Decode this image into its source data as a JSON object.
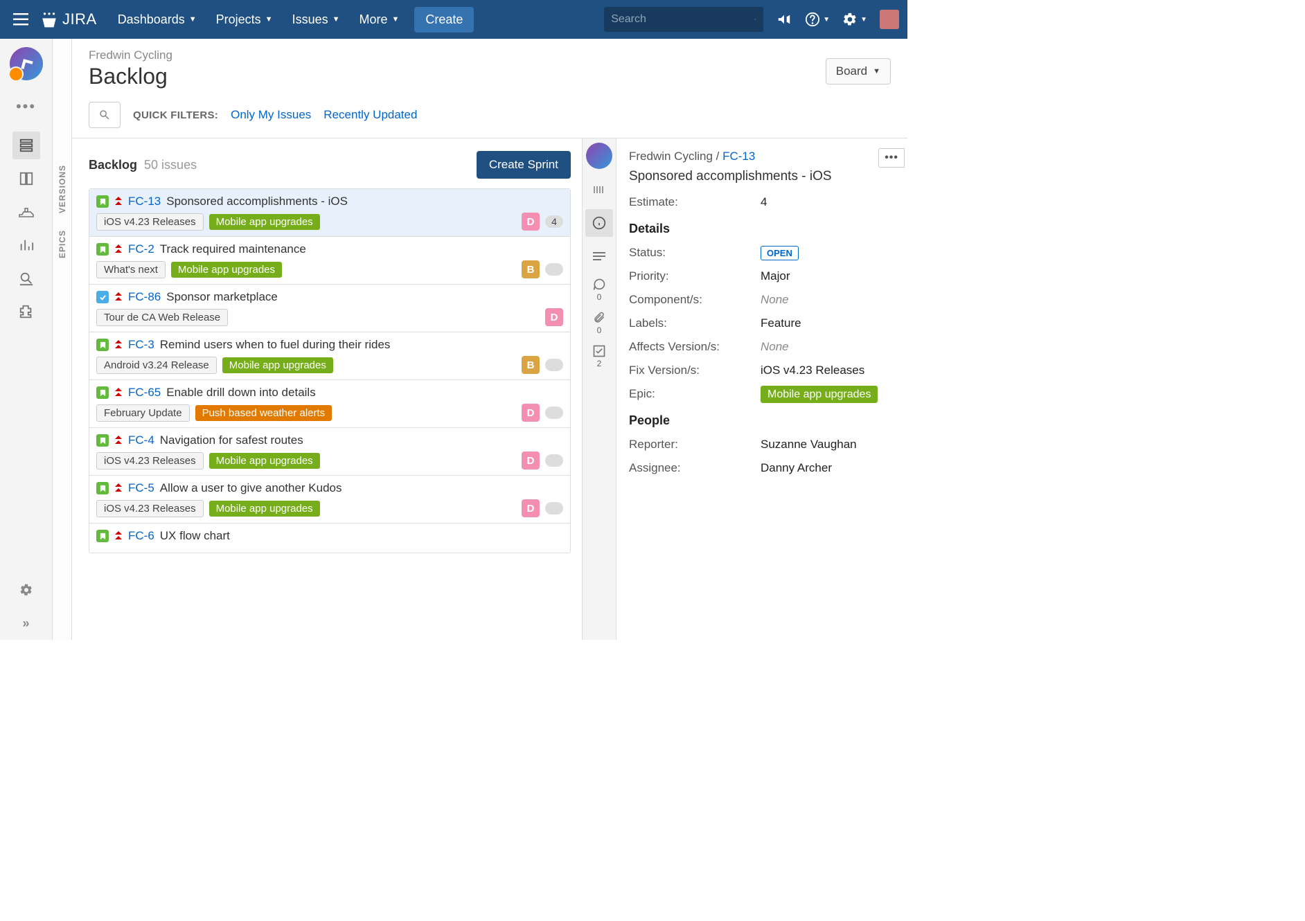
{
  "topbar": {
    "nav": [
      "Dashboards",
      "Projects",
      "Issues",
      "More"
    ],
    "create": "Create",
    "search_placeholder": "Search"
  },
  "vert_tabs": [
    "VERSIONS",
    "EPICS"
  ],
  "header": {
    "project": "Fredwin Cycling",
    "title": "Backlog",
    "board_btn": "Board"
  },
  "filters": {
    "label": "QUICK FILTERS:",
    "links": [
      "Only My Issues",
      "Recently Updated"
    ]
  },
  "backlog": {
    "title": "Backlog",
    "count": "50 issues",
    "create_sprint": "Create Sprint",
    "items": [
      {
        "type": "story",
        "key": "FC-13",
        "summary": "Sponsored accomplishments - iOS",
        "pills": [
          "iOS v4.23 Releases"
        ],
        "epic": "Mobile app upgrades",
        "epic_color": "green",
        "avatar": "D",
        "estimate": "4",
        "selected": true
      },
      {
        "type": "story",
        "key": "FC-2",
        "summary": "Track required maintenance",
        "pills": [
          "What's next"
        ],
        "epic": "Mobile app upgrades",
        "epic_color": "green",
        "avatar": "B",
        "estimate": ""
      },
      {
        "type": "task",
        "key": "FC-86",
        "summary": "Sponsor marketplace",
        "pills": [
          "Tour de CA Web Release"
        ],
        "epic": null,
        "avatar": "D",
        "estimate": null
      },
      {
        "type": "story",
        "key": "FC-3",
        "summary": "Remind users when to fuel during their rides",
        "pills": [
          "Android v3.24 Release"
        ],
        "epic": "Mobile app upgrades",
        "epic_color": "green",
        "avatar": "B",
        "estimate": ""
      },
      {
        "type": "story",
        "key": "FC-65",
        "summary": "Enable drill down into details",
        "pills": [
          "February Update"
        ],
        "epic": "Push based weather alerts",
        "epic_color": "orange",
        "avatar": "D",
        "estimate": ""
      },
      {
        "type": "story",
        "key": "FC-4",
        "summary": "Navigation for safest routes",
        "pills": [
          "iOS v4.23 Releases"
        ],
        "epic": "Mobile app upgrades",
        "epic_color": "green",
        "avatar": "D",
        "estimate": ""
      },
      {
        "type": "story",
        "key": "FC-5",
        "summary": "Allow a user to give another Kudos",
        "pills": [
          "iOS v4.23 Releases"
        ],
        "epic": "Mobile app upgrades",
        "epic_color": "green",
        "avatar": "D",
        "estimate": ""
      },
      {
        "type": "story",
        "key": "FC-6",
        "summary": "UX flow chart",
        "pills": [],
        "epic": null,
        "avatar": null,
        "estimate": null
      }
    ]
  },
  "detail_rail": {
    "comments": "0",
    "attachments": "0",
    "subtasks": "2"
  },
  "detail": {
    "breadcrumb_project": "Fredwin Cycling",
    "breadcrumb_sep": " / ",
    "breadcrumb_key": "FC-13",
    "title": "Sponsored accomplishments - iOS",
    "estimate_label": "Estimate:",
    "estimate_value": "4",
    "details_h": "Details",
    "status_label": "Status:",
    "status_value": "OPEN",
    "priority_label": "Priority:",
    "priority_value": "Major",
    "components_label": "Component/s:",
    "components_value": "None",
    "labels_label": "Labels:",
    "labels_value": "Feature",
    "affects_label": "Affects Version/s:",
    "affects_value": "None",
    "fix_label": "Fix Version/s:",
    "fix_value": "iOS v4.23 Releases",
    "epic_label": "Epic:",
    "epic_value": "Mobile app upgrades",
    "people_h": "People",
    "reporter_label": "Reporter:",
    "reporter_value": "Suzanne Vaughan",
    "assignee_label": "Assignee:",
    "assignee_value": "Danny Archer"
  }
}
